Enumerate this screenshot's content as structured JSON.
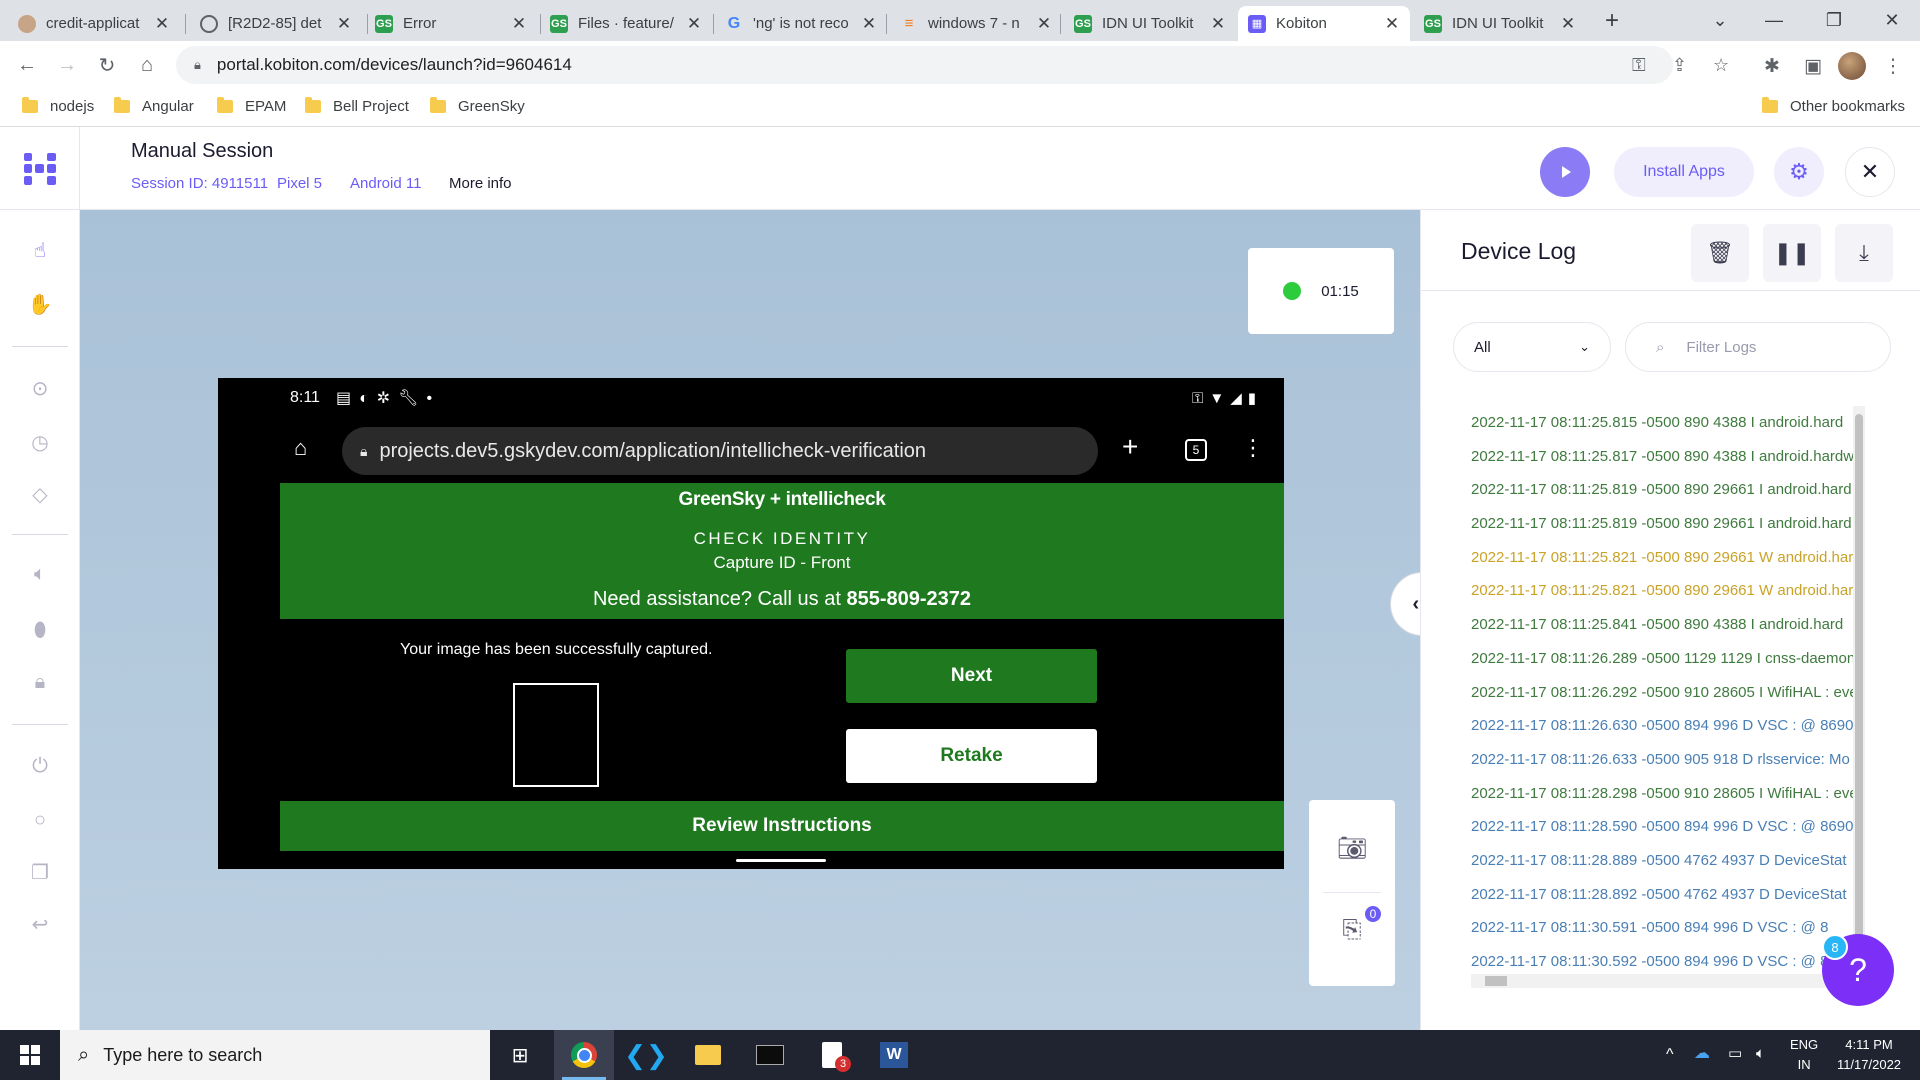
{
  "browser": {
    "tabs": [
      {
        "title": "credit-applicat",
        "favicon": "person-avatar-icon",
        "active": false
      },
      {
        "title": "[R2D2-85] det",
        "favicon": "globe-icon",
        "active": false
      },
      {
        "title": "Error",
        "favicon": "gs-icon",
        "active": false
      },
      {
        "title": "Files · feature/",
        "favicon": "gs-icon",
        "active": false
      },
      {
        "title": "'ng' is not reco",
        "favicon": "google-icon",
        "active": false
      },
      {
        "title": "windows 7 - n",
        "favicon": "stackoverflow-icon",
        "active": false
      },
      {
        "title": "IDN UI Toolkit",
        "favicon": "gs-icon",
        "active": false
      },
      {
        "title": "Kobiton",
        "favicon": "kobiton-icon",
        "active": true
      },
      {
        "title": "IDN UI Toolkit",
        "favicon": "gs-icon",
        "active": false
      }
    ],
    "url": "portal.kobiton.com/devices/launch?id=9604614",
    "bookmarks": [
      "nodejs",
      "Angular",
      "EPAM",
      "Bell Project",
      "GreenSky"
    ],
    "other_bookmarks": "Other bookmarks"
  },
  "session": {
    "title": "Manual Session",
    "session_id": "Session ID: 4911511",
    "device": "Pixel 5",
    "os": "Android 11",
    "more_info": "More info",
    "install_apps": "Install Apps",
    "timer": "01:15",
    "accent": "#6b5cf6"
  },
  "device_screen": {
    "status": {
      "time": "8:11"
    },
    "url": "projects.dev5.gskydev.com/application/intellicheck-verification",
    "tab_count": "5",
    "logo_text": "GreenSky + intellicheck",
    "check_identity": "CHECK IDENTITY",
    "capture_label": "Capture ID - Front",
    "help_prefix": "Need assistance? Call us at ",
    "help_phone": "855-809-2372",
    "captured_msg": "Your image has been successfully captured.",
    "next": "Next",
    "retake": "Retake",
    "review": "Review Instructions",
    "brand_green": "#1f7a1f"
  },
  "tools": {
    "badge_count": "0"
  },
  "log": {
    "title": "Device Log",
    "level_selected": "All",
    "filter_placeholder": "Filter Logs",
    "lines": [
      {
        "text": "2022-11-17 08:11:25.815 -0500 890 4388 I android.hard",
        "color": "#3f7a3f"
      },
      {
        "text": "2022-11-17 08:11:25.817 -0500 890 4388 I android.hardw",
        "color": "#3f7a3f"
      },
      {
        "text": "2022-11-17 08:11:25.819 -0500 890 29661 I android.hard",
        "color": "#3f7a3f"
      },
      {
        "text": "2022-11-17 08:11:25.819 -0500 890 29661 I android.hard",
        "color": "#3f7a3f"
      },
      {
        "text": "2022-11-17 08:11:25.821 -0500 890 29661 W android.har",
        "color": "#c9a227"
      },
      {
        "text": "2022-11-17 08:11:25.821 -0500 890 29661 W android.har",
        "color": "#c9a227"
      },
      {
        "text": "2022-11-17 08:11:25.841 -0500 890 4388 I android.hard",
        "color": "#3f7a3f"
      },
      {
        "text": "2022-11-17 08:11:26.289 -0500 1129 1129 I cnss-daemon",
        "color": "#3f7a3f"
      },
      {
        "text": "2022-11-17 08:11:26.292 -0500 910 28605 I WifiHAL : eve",
        "color": "#3f7a3f"
      },
      {
        "text": "2022-11-17 08:11:26.630 -0500 894 996 D VSC : @ 8690",
        "color": "#4a7fb5"
      },
      {
        "text": "2022-11-17 08:11:26.633 -0500 905 918 D rlsservice: Mo",
        "color": "#4a7fb5"
      },
      {
        "text": "2022-11-17 08:11:28.298 -0500 910 28605 I WifiHAL : eve",
        "color": "#3f7a3f"
      },
      {
        "text": "2022-11-17 08:11:28.590 -0500 894 996 D VSC : @ 8690",
        "color": "#4a7fb5"
      },
      {
        "text": "2022-11-17 08:11:28.889 -0500 4762 4937 D DeviceStat",
        "color": "#4a7fb5"
      },
      {
        "text": "2022-11-17 08:11:28.892 -0500 4762 4937 D DeviceStat",
        "color": "#4a7fb5"
      },
      {
        "text": "2022-11-17 08:11:30.591 -0500 894 996 D VSC : @ 8",
        "color": "#4a7fb5"
      },
      {
        "text": "2022-11-17 08:11:30.592 -0500 894 996 D VSC : @ 8",
        "color": "#4a7fb5"
      }
    ],
    "help_badge": "8"
  },
  "taskbar": {
    "search_placeholder": "Type here to search",
    "lang_top": "ENG",
    "lang_bottom": "IN",
    "time": "4:11 PM",
    "date": "11/17/2022",
    "file_badge": "3"
  }
}
